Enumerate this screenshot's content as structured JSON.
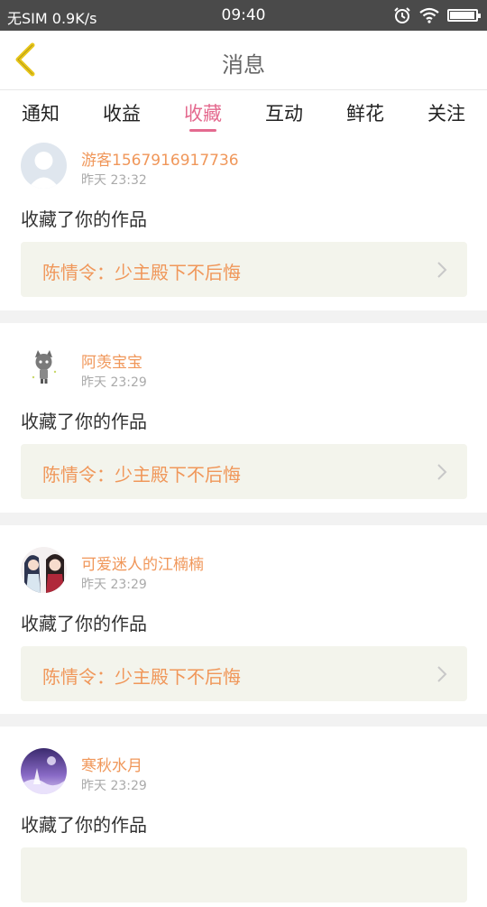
{
  "status": {
    "carrier": "无SIM",
    "speed": "0.9K/s",
    "time": "09:40",
    "battery_level": 0.9
  },
  "header": {
    "title": "消息",
    "back_icon": "chevron-left-icon",
    "accent": "#e8c61a"
  },
  "tabs": [
    {
      "label": "通知"
    },
    {
      "label": "收益"
    },
    {
      "label": "收藏",
      "active": true
    },
    {
      "label": "互动"
    },
    {
      "label": "鲜花"
    },
    {
      "label": "关注"
    }
  ],
  "items": [
    {
      "username": "游客1567916917736",
      "time": "昨天 23:32",
      "action": "收藏了你的作品",
      "work": "陈情令：少主殿下不后悔",
      "avatar": "default-avatar"
    },
    {
      "username": "阿羡宝宝",
      "time": "昨天 23:29",
      "action": "收藏了你的作品",
      "work": "陈情令：少主殿下不后悔",
      "avatar": "cartoon-cat-avatar"
    },
    {
      "username": "可爱迷人的江楠楠",
      "time": "昨天 23:29",
      "action": "收藏了你的作品",
      "work": "陈情令：少主殿下不后悔",
      "avatar": "anime-pair-avatar"
    },
    {
      "username": "寒秋水月",
      "time": "昨天 23:29",
      "action": "收藏了你的作品",
      "work": "",
      "avatar": "purple-night-avatar"
    }
  ],
  "colors": {
    "active_tab": "#e46a8f",
    "username": "#f0975a",
    "card_bg": "#f3f4ec"
  }
}
